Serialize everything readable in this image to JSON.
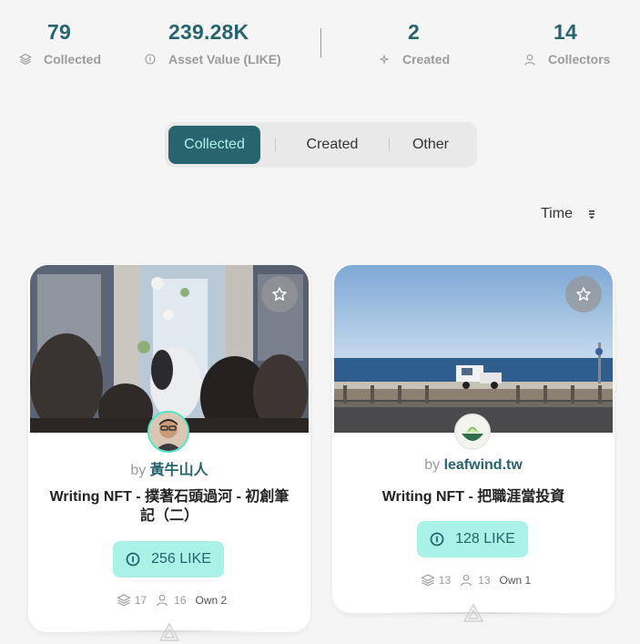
{
  "stats": [
    {
      "value": "79",
      "label": "Collected",
      "icon": "layers-icon"
    },
    {
      "value": "239.28K",
      "label": "Asset Value (LIKE)",
      "icon": "like-coin-icon"
    },
    {
      "value": "2",
      "label": "Created",
      "icon": "sparkle-icon"
    },
    {
      "value": "14",
      "label": "Collectors",
      "icon": "person-icon"
    }
  ],
  "tabs": [
    {
      "label": "Collected",
      "active": true
    },
    {
      "label": "Created",
      "active": false
    },
    {
      "label": "Other",
      "active": false
    }
  ],
  "sort": {
    "label": "Time",
    "icon": "sort-icon"
  },
  "cards": [
    {
      "by": "by",
      "author": "黃牛山人",
      "title": "Writing NFT - 撲著石頭過河 - 初創筆記（二）",
      "price": "256 LIKE",
      "collected": "17",
      "collectors": "16",
      "own": "Own 2"
    },
    {
      "by": "by",
      "author": "leafwind.tw",
      "title": "Writing NFT - 把職涯當投資",
      "price": "128 LIKE",
      "collected": "13",
      "collectors": "13",
      "own": "Own 1"
    }
  ],
  "colors": {
    "accent": "#28646e",
    "accent_light": "#aaf1e7",
    "muted": "#9b9b9b"
  }
}
